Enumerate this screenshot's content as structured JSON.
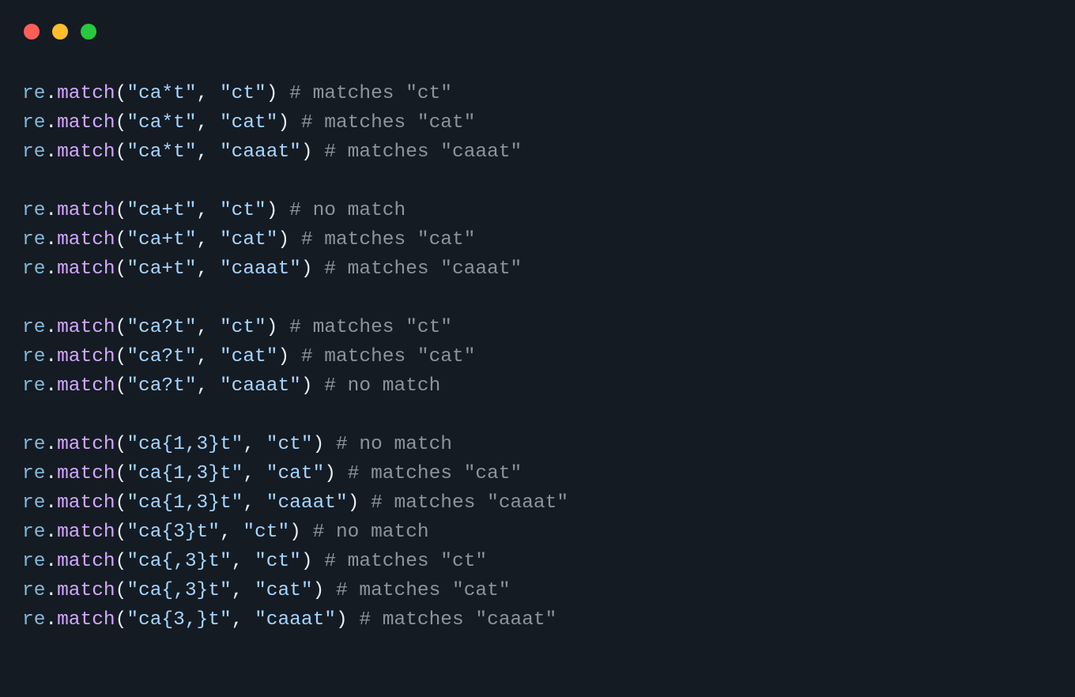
{
  "traffic": {
    "red": "#ff5f56",
    "yellow": "#ffbd2e",
    "green": "#27c93f"
  },
  "tokens": {
    "obj": "re",
    "dot": ".",
    "fn": "match",
    "open": "(",
    "close": ")",
    "comma": ", "
  },
  "lines": [
    {
      "pattern": "\"ca*t\"",
      "arg": "\"ct\"",
      "comment": "# matches \"ct\""
    },
    {
      "pattern": "\"ca*t\"",
      "arg": "\"cat\"",
      "comment": "# matches \"cat\""
    },
    {
      "pattern": "\"ca*t\"",
      "arg": "\"caaat\"",
      "comment": "# matches \"caaat\""
    },
    null,
    {
      "pattern": "\"ca+t\"",
      "arg": "\"ct\"",
      "comment": "# no match"
    },
    {
      "pattern": "\"ca+t\"",
      "arg": "\"cat\"",
      "comment": "# matches \"cat\""
    },
    {
      "pattern": "\"ca+t\"",
      "arg": "\"caaat\"",
      "comment": "# matches \"caaat\""
    },
    null,
    {
      "pattern": "\"ca?t\"",
      "arg": "\"ct\"",
      "comment": "# matches \"ct\""
    },
    {
      "pattern": "\"ca?t\"",
      "arg": "\"cat\"",
      "comment": "# matches \"cat\""
    },
    {
      "pattern": "\"ca?t\"",
      "arg": "\"caaat\"",
      "comment": "# no match"
    },
    null,
    {
      "pattern": "\"ca{1,3}t\"",
      "arg": "\"ct\"",
      "comment": "# no match"
    },
    {
      "pattern": "\"ca{1,3}t\"",
      "arg": "\"cat\"",
      "comment": "# matches \"cat\""
    },
    {
      "pattern": "\"ca{1,3}t\"",
      "arg": "\"caaat\"",
      "comment": "# matches \"caaat\""
    },
    {
      "pattern": "\"ca{3}t\"",
      "arg": "\"ct\"",
      "comment": "# no match"
    },
    {
      "pattern": "\"ca{,3}t\"",
      "arg": "\"ct\"",
      "comment": "# matches \"ct\""
    },
    {
      "pattern": "\"ca{,3}t\"",
      "arg": "\"cat\"",
      "comment": "# matches \"cat\""
    },
    {
      "pattern": "\"ca{3,}t\"",
      "arg": "\"caaat\"",
      "comment": "# matches \"caaat\""
    }
  ]
}
